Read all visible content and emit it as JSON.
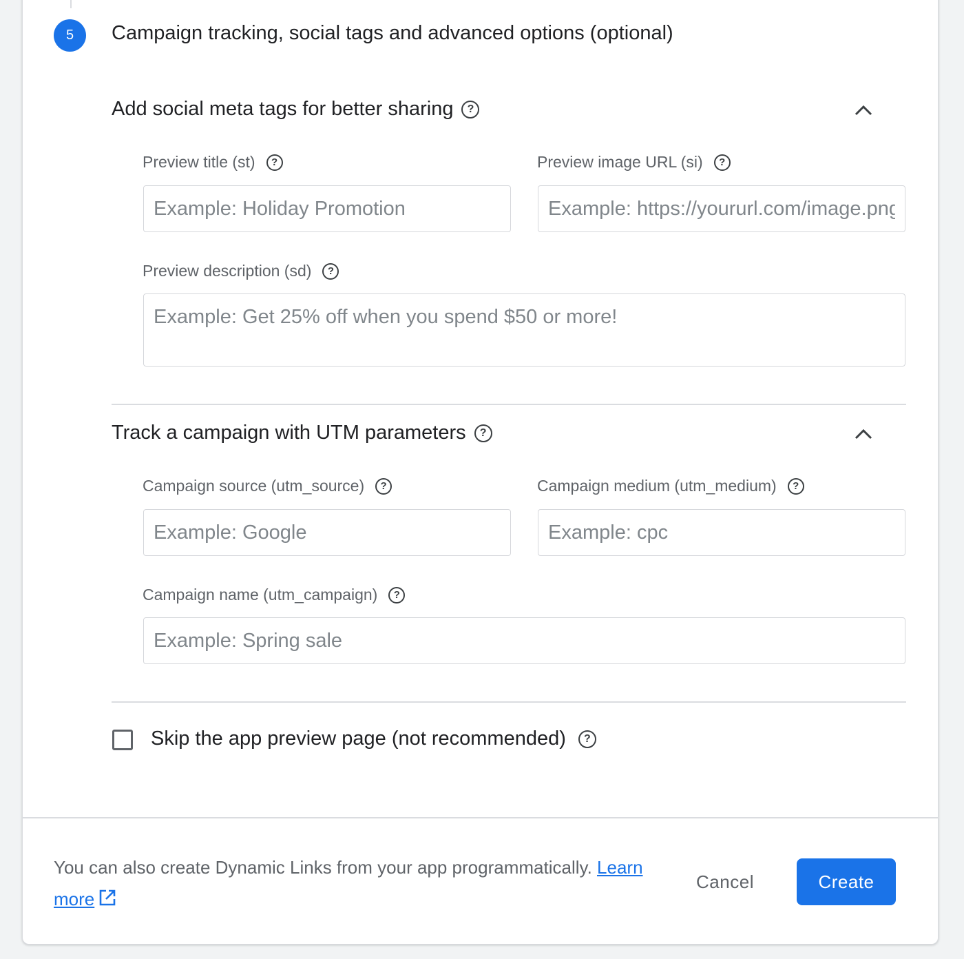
{
  "step": {
    "number": "5",
    "title": "Campaign tracking, social tags and advanced options (optional)"
  },
  "social": {
    "title": "Add social meta tags for better sharing",
    "preview_title": {
      "label": "Preview title (st)",
      "placeholder": "Example: Holiday Promotion",
      "value": ""
    },
    "preview_image": {
      "label": "Preview image URL (si)",
      "placeholder": "Example: https://yoururl.com/image.png",
      "value": ""
    },
    "preview_description": {
      "label": "Preview description (sd)",
      "placeholder": "Example: Get 25% off when you spend $50 or more!",
      "value": ""
    }
  },
  "utm": {
    "title": "Track a campaign with UTM parameters",
    "source": {
      "label": "Campaign source (utm_source)",
      "placeholder": "Example: Google",
      "value": ""
    },
    "medium": {
      "label": "Campaign medium (utm_medium)",
      "placeholder": "Example: cpc",
      "value": ""
    },
    "name": {
      "label": "Campaign name (utm_campaign)",
      "placeholder": "Example: Spring sale",
      "value": ""
    }
  },
  "skip_preview": {
    "label": "Skip the app preview page (not recommended)",
    "checked": false
  },
  "footer": {
    "text": "You can also create Dynamic Links from your app programmatically.",
    "link_part1": "Learn",
    "link_part2": "more",
    "cancel_label": "Cancel",
    "create_label": "Create"
  },
  "icons": {
    "help": "?"
  },
  "colors": {
    "accent": "#1a73e8",
    "text_primary": "#202124",
    "text_secondary": "#5f6368",
    "divider": "#dadce0"
  }
}
